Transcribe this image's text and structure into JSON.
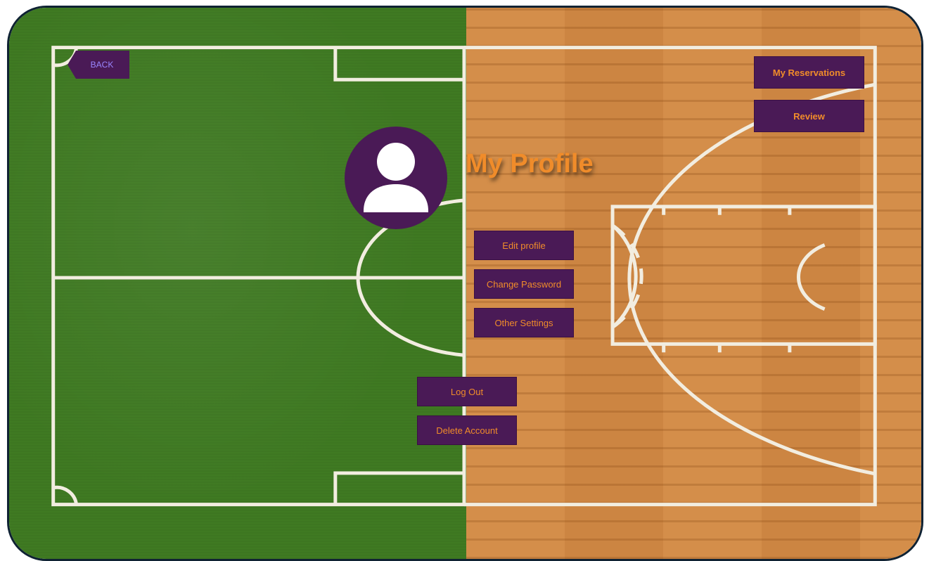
{
  "nav": {
    "back_label": "BACK"
  },
  "profile": {
    "title": "My Profile",
    "avatar_icon": "user-avatar-icon"
  },
  "top_actions": {
    "reservations_label": "My Reservations",
    "review_label": "Review"
  },
  "settings": {
    "edit_profile_label": "Edit profile",
    "change_password_label": "Change Password",
    "other_settings_label": "Other Settings"
  },
  "account": {
    "logout_label": "Log Out",
    "delete_label": "Delete Account"
  },
  "colors": {
    "button_bg": "#4a1a56",
    "button_text": "#f08c2a",
    "back_text": "#9a86ff",
    "field_green": "#3f7a22",
    "court_wood": "#d28a45"
  }
}
